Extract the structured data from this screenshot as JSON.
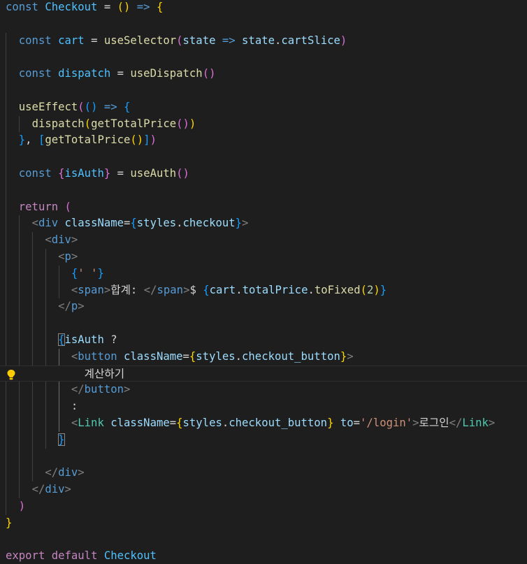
{
  "editor": {
    "language": "javascript-react",
    "theme_background": "#1e1e1e",
    "lines": [
      [
        [
          "const",
          "kw"
        ],
        [
          " ",
          "txt"
        ],
        [
          "Checkout",
          "cst"
        ],
        [
          " = ",
          "txt"
        ],
        [
          "(",
          "b1"
        ],
        [
          ")",
          "b1"
        ],
        [
          " ",
          "txt"
        ],
        [
          "=>",
          "kw"
        ],
        [
          " ",
          "txt"
        ],
        [
          "{",
          "b1"
        ]
      ],
      [],
      [
        [
          "  ",
          "txt"
        ],
        [
          "const",
          "kw"
        ],
        [
          " ",
          "txt"
        ],
        [
          "cart",
          "cst"
        ],
        [
          " = ",
          "txt"
        ],
        [
          "useSelector",
          "fn"
        ],
        [
          "(",
          "b2"
        ],
        [
          "state",
          "var"
        ],
        [
          " ",
          "txt"
        ],
        [
          "=>",
          "kw"
        ],
        [
          " ",
          "txt"
        ],
        [
          "state",
          "var"
        ],
        [
          ".",
          "txt"
        ],
        [
          "cartSlice",
          "var"
        ],
        [
          ")",
          "b2"
        ]
      ],
      [],
      [
        [
          "  ",
          "txt"
        ],
        [
          "const",
          "kw"
        ],
        [
          " ",
          "txt"
        ],
        [
          "dispatch",
          "cst"
        ],
        [
          " = ",
          "txt"
        ],
        [
          "useDispatch",
          "fn"
        ],
        [
          "(",
          "b2"
        ],
        [
          ")",
          "b2"
        ]
      ],
      [],
      [
        [
          "  ",
          "txt"
        ],
        [
          "useEffect",
          "fn"
        ],
        [
          "(",
          "b2"
        ],
        [
          "(",
          "b3"
        ],
        [
          ")",
          "b3"
        ],
        [
          " ",
          "txt"
        ],
        [
          "=>",
          "kw"
        ],
        [
          " ",
          "txt"
        ],
        [
          "{",
          "b3"
        ]
      ],
      [
        [
          "    ",
          "txt"
        ],
        [
          "dispatch",
          "fn"
        ],
        [
          "(",
          "b1"
        ],
        [
          "getTotalPrice",
          "fn"
        ],
        [
          "(",
          "b2"
        ],
        [
          ")",
          "b2"
        ],
        [
          ")",
          "b1"
        ]
      ],
      [
        [
          "  ",
          "txt"
        ],
        [
          "}",
          "b3"
        ],
        [
          ", ",
          "txt"
        ],
        [
          "[",
          "b3"
        ],
        [
          "getTotalPrice",
          "fn"
        ],
        [
          "(",
          "b1"
        ],
        [
          ")",
          "b1"
        ],
        [
          "]",
          "b3"
        ],
        [
          ")",
          "b2"
        ]
      ],
      [],
      [
        [
          "  ",
          "txt"
        ],
        [
          "const",
          "kw"
        ],
        [
          " ",
          "txt"
        ],
        [
          "{",
          "b2"
        ],
        [
          "isAuth",
          "cst"
        ],
        [
          "}",
          "b2"
        ],
        [
          " = ",
          "txt"
        ],
        [
          "useAuth",
          "fn"
        ],
        [
          "(",
          "b2"
        ],
        [
          ")",
          "b2"
        ]
      ],
      [],
      [
        [
          "  ",
          "txt"
        ],
        [
          "return",
          "ctl"
        ],
        [
          " ",
          "txt"
        ],
        [
          "(",
          "b2"
        ]
      ],
      [
        [
          "    ",
          "txt"
        ],
        [
          "<",
          "pun"
        ],
        [
          "div",
          "tag"
        ],
        [
          " ",
          "txt"
        ],
        [
          "className",
          "attr"
        ],
        [
          "=",
          "txt"
        ],
        [
          "{",
          "b3"
        ],
        [
          "styles",
          "var"
        ],
        [
          ".",
          "txt"
        ],
        [
          "checkout",
          "var"
        ],
        [
          "}",
          "b3"
        ],
        [
          ">",
          "pun"
        ]
      ],
      [
        [
          "      ",
          "txt"
        ],
        [
          "<",
          "pun"
        ],
        [
          "div",
          "tag"
        ],
        [
          ">",
          "pun"
        ]
      ],
      [
        [
          "        ",
          "txt"
        ],
        [
          "<",
          "pun"
        ],
        [
          "p",
          "tag"
        ],
        [
          ">",
          "pun"
        ]
      ],
      [
        [
          "          ",
          "txt"
        ],
        [
          "{",
          "b3"
        ],
        [
          "' '",
          "str"
        ],
        [
          "}",
          "b3"
        ]
      ],
      [
        [
          "          ",
          "txt"
        ],
        [
          "<",
          "pun"
        ],
        [
          "span",
          "tag"
        ],
        [
          ">",
          "pun"
        ],
        [
          "합계: ",
          "txt"
        ],
        [
          "</",
          "pun"
        ],
        [
          "span",
          "tag"
        ],
        [
          ">",
          "pun"
        ],
        [
          "$ ",
          "txt"
        ],
        [
          "{",
          "b3"
        ],
        [
          "cart",
          "var"
        ],
        [
          ".",
          "txt"
        ],
        [
          "totalPrice",
          "var"
        ],
        [
          ".",
          "txt"
        ],
        [
          "toFixed",
          "fn"
        ],
        [
          "(",
          "b1"
        ],
        [
          "2",
          "num"
        ],
        [
          ")",
          "b1"
        ],
        [
          "}",
          "b3"
        ]
      ],
      [
        [
          "        ",
          "txt"
        ],
        [
          "</",
          "pun"
        ],
        [
          "p",
          "tag"
        ],
        [
          ">",
          "pun"
        ]
      ],
      [],
      [
        [
          "        ",
          "txt"
        ],
        [
          "{",
          "b3box"
        ],
        [
          "isAuth",
          "var"
        ],
        [
          " ?",
          "txt"
        ]
      ],
      [
        [
          "          ",
          "txt"
        ],
        [
          "<",
          "pun"
        ],
        [
          "button",
          "tag"
        ],
        [
          " ",
          "txt"
        ],
        [
          "className",
          "attr"
        ],
        [
          "=",
          "txt"
        ],
        [
          "{",
          "b1"
        ],
        [
          "styles",
          "var"
        ],
        [
          ".",
          "txt"
        ],
        [
          "checkout_button",
          "var"
        ],
        [
          "}",
          "b1"
        ],
        [
          ">",
          "pun"
        ]
      ],
      [
        [
          "            ",
          "txt"
        ],
        [
          "계산하기",
          "txt"
        ]
      ],
      [
        [
          "          ",
          "txt"
        ],
        [
          "</",
          "pun"
        ],
        [
          "button",
          "tag"
        ],
        [
          ">",
          "pun"
        ]
      ],
      [
        [
          "          ",
          "txt"
        ],
        [
          ":",
          "txt"
        ]
      ],
      [
        [
          "          ",
          "txt"
        ],
        [
          "<",
          "pun"
        ],
        [
          "Link",
          "comp"
        ],
        [
          " ",
          "txt"
        ],
        [
          "className",
          "attr"
        ],
        [
          "=",
          "txt"
        ],
        [
          "{",
          "b1"
        ],
        [
          "styles",
          "var"
        ],
        [
          ".",
          "txt"
        ],
        [
          "checkout_button",
          "var"
        ],
        [
          "}",
          "b1"
        ],
        [
          " ",
          "txt"
        ],
        [
          "to",
          "attr"
        ],
        [
          "=",
          "txt"
        ],
        [
          "'/login'",
          "str"
        ],
        [
          ">",
          "pun"
        ],
        [
          "로그인",
          "txt"
        ],
        [
          "</",
          "pun"
        ],
        [
          "Link",
          "comp"
        ],
        [
          ">",
          "pun"
        ]
      ],
      [
        [
          "        ",
          "txt"
        ],
        [
          "}",
          "b3box"
        ]
      ],
      [],
      [
        [
          "      ",
          "txt"
        ],
        [
          "</",
          "pun"
        ],
        [
          "div",
          "tag"
        ],
        [
          ">",
          "pun"
        ]
      ],
      [
        [
          "    ",
          "txt"
        ],
        [
          "</",
          "pun"
        ],
        [
          "div",
          "tag"
        ],
        [
          ">",
          "pun"
        ]
      ],
      [
        [
          "  ",
          "txt"
        ],
        [
          ")",
          "b2"
        ]
      ],
      [
        [
          "}",
          "b1"
        ]
      ],
      [],
      [
        [
          "export",
          "ctl"
        ],
        [
          " ",
          "txt"
        ],
        [
          "default",
          "ctl"
        ],
        [
          " ",
          "txt"
        ],
        [
          "Checkout",
          "cst"
        ]
      ]
    ],
    "current_line_index": 22,
    "lightbulb_line_index": 22,
    "lightbulb_icon": "lightbulb-icon"
  }
}
